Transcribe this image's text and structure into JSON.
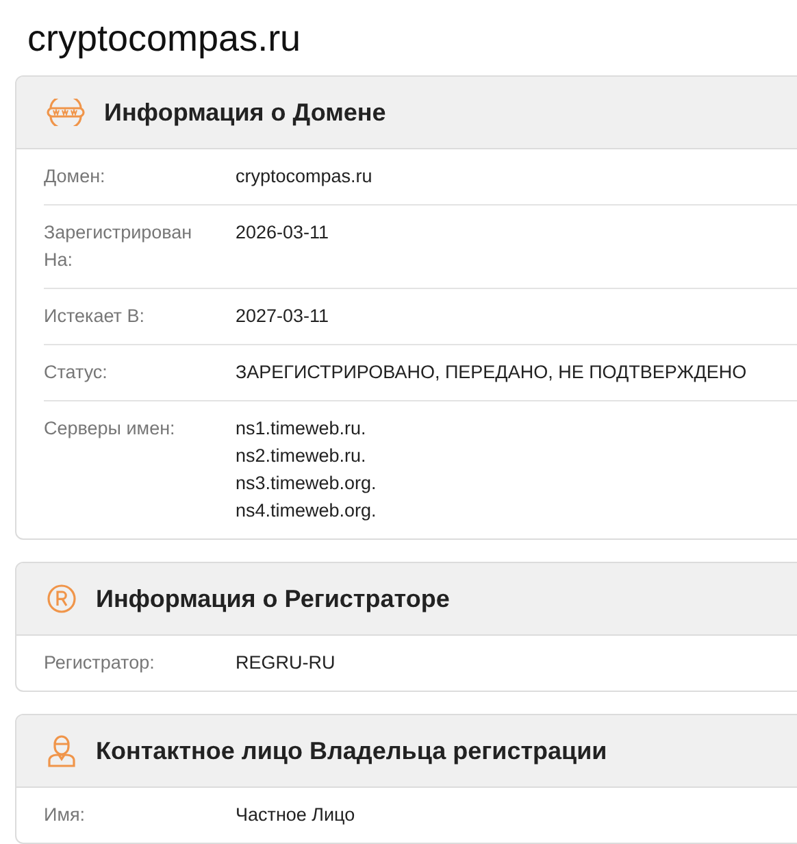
{
  "title": "cryptocompas.ru",
  "sections": [
    {
      "kind": "www",
      "heading": "Информация о Домене",
      "rows": [
        {
          "label": "Домен:",
          "values": [
            "cryptocompas.ru"
          ]
        },
        {
          "label": "Зарегистрирован На:",
          "values": [
            "2026-03-11"
          ]
        },
        {
          "label": "Истекает В:",
          "values": [
            "2027-03-11"
          ]
        },
        {
          "label": "Статус:",
          "values": [
            "ЗАРЕГИСТРИРОВАНО, ПЕРЕДАНО, НЕ ПОДТВЕРЖДЕНО"
          ]
        },
        {
          "label": "Серверы имен:",
          "values": [
            "ns1.timeweb.ru.",
            "ns2.timeweb.ru.",
            "ns3.timeweb.org.",
            "ns4.timeweb.org."
          ]
        }
      ]
    },
    {
      "kind": "registered",
      "heading": "Информация о Регистраторе",
      "rows": [
        {
          "label": "Регистратор:",
          "values": [
            "REGRU-RU"
          ]
        }
      ]
    },
    {
      "kind": "person",
      "heading": "Контактное лицо Владельца регистрации",
      "rows": [
        {
          "label": "Имя:",
          "values": [
            "Частное Лицо"
          ]
        }
      ]
    }
  ]
}
